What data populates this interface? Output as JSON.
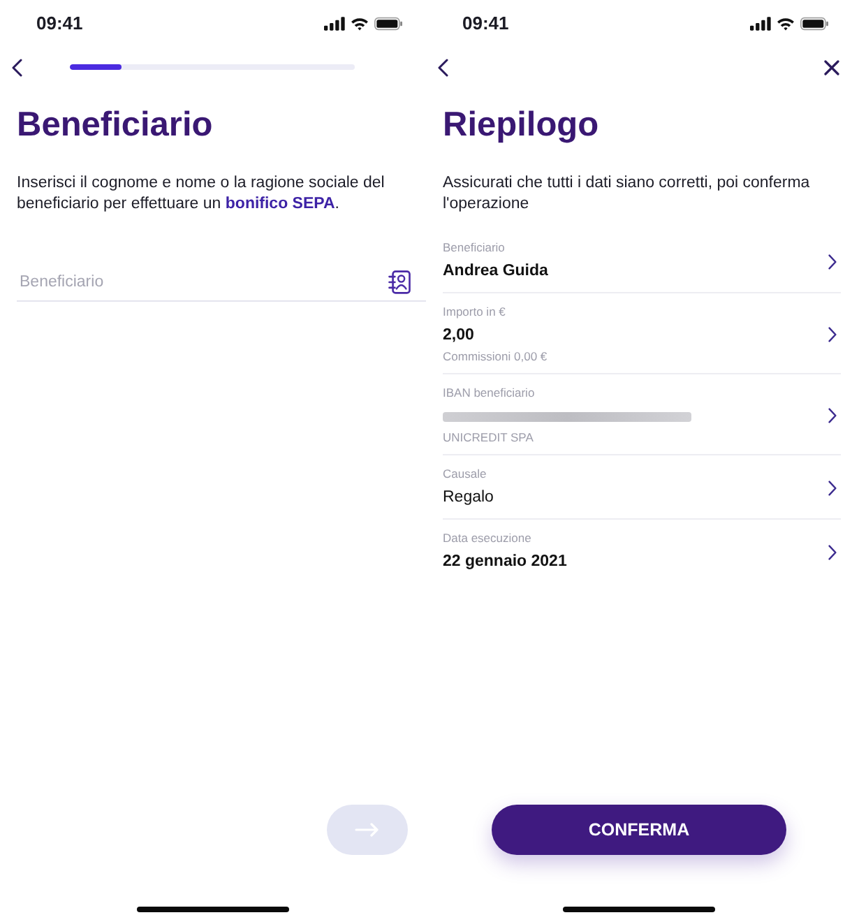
{
  "screens": [
    {
      "status_bar": {
        "time": "09:41"
      },
      "nav": {
        "back": true
      },
      "progress": {
        "level": 0.18
      },
      "title": "Beneficiario",
      "description": "Inserisci il cognome e nome o la ragione sociale del beneficiario per effettuare un **bonifico SEPA**.",
      "input": {
        "placeholder": "Beneficiario"
      },
      "next_button": {
        "disabled": true
      }
    },
    {
      "status_bar": {
        "time": "09:41"
      },
      "nav": {
        "back": true,
        "close": true
      },
      "title": "Riepilogo",
      "description": "Assicurati che tutti i dati siano corretti, poi conferma l'operazione",
      "summary": [
        {
          "label": "Beneficiario",
          "value": "Andrea Guida",
          "kind": "strong"
        },
        {
          "label": "Importo in €",
          "value": "2,00",
          "note": "Commissioni 0,00 €",
          "kind": "strong"
        },
        {
          "label": "IBAN beneficiario",
          "note": "UNICREDIT SPA",
          "kind": "masked"
        },
        {
          "label": "Causale",
          "value": "Regalo",
          "kind": "plain"
        },
        {
          "label": "Data esecuzione",
          "value": "22 gennaio 2021",
          "kind": "strong"
        }
      ],
      "confirm_button": {
        "label": "CONFERMA",
        "disabled": false
      }
    }
  ]
}
